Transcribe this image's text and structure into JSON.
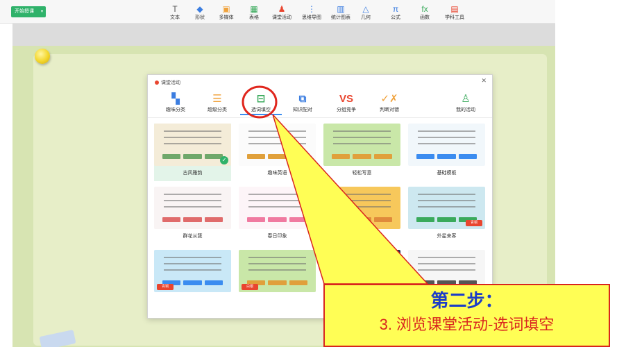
{
  "toolbar": {
    "start_label": "开始授课",
    "tools": [
      {
        "label": "文本",
        "icon": "T",
        "color": "#555555"
      },
      {
        "label": "形状",
        "icon": "◆",
        "color": "#3b7de0"
      },
      {
        "label": "多媒体",
        "icon": "▣",
        "color": "#f0a23b"
      },
      {
        "label": "表格",
        "icon": "▦",
        "color": "#3aaa5c"
      },
      {
        "label": "课堂活动",
        "icon": "♟",
        "color": "#e9452f"
      },
      {
        "label": "思维导图",
        "icon": "⋮",
        "color": "#3b7de0"
      },
      {
        "label": "统计图表",
        "icon": "▥",
        "color": "#3b7de0"
      },
      {
        "label": "几何",
        "icon": "△",
        "color": "#3b7de0"
      },
      {
        "label": "公式",
        "icon": "π",
        "color": "#3b7de0"
      },
      {
        "label": "函数",
        "icon": "fx",
        "color": "#3aaa5c"
      },
      {
        "label": "学科工具",
        "icon": "▤",
        "color": "#e9452f"
      }
    ]
  },
  "dialog": {
    "title": "课堂活动",
    "categories": [
      {
        "label": "趣味分类",
        "icon": "▚",
        "color": "#3b7de0"
      },
      {
        "label": "超级分类",
        "icon": "☰",
        "color": "#f0a23b"
      },
      {
        "label": "选词填空",
        "icon": "⊟",
        "color": "#3aaa5c"
      },
      {
        "label": "知识配对",
        "icon": "⧉",
        "color": "#3b7de0"
      },
      {
        "label": "分组竞争",
        "icon": "VS",
        "color": "#e9452f"
      },
      {
        "label": "判断对错",
        "icon": "✓✗",
        "color": "#f0a23b"
      },
      {
        "label": "我的活动",
        "icon": "♙",
        "color": "#3aaa5c"
      }
    ],
    "templates": [
      {
        "name": "古风雅韵",
        "bg": "#f4ecd8",
        "pill": "#6fa86a"
      },
      {
        "name": "趣味英语",
        "bg": "#fbfbfb",
        "pill": "#e0a03b"
      },
      {
        "name": "轻松写意",
        "bg": "#c9e7a8",
        "pill": "#e0a03b"
      },
      {
        "name": "基础模板",
        "bg": "#f1f7fb",
        "pill": "#3b8cf0"
      },
      {
        "name": "群花从簇",
        "bg": "#f9f4f4",
        "pill": "#e06b6b"
      },
      {
        "name": "春日印象",
        "bg": "#fdf5f8",
        "pill": "#f07aa0"
      },
      {
        "name": "",
        "bg": "#f7c85b",
        "pill": "#e08a3b"
      },
      {
        "name": "外星来客",
        "bg": "#cde8f0",
        "pill": "#3aaa5c"
      },
      {
        "name": "",
        "bg": "#c9e8f7",
        "pill": "#3b8cf0",
        "badge": "青铜"
      },
      {
        "name": "",
        "bg": "#c9e7a8",
        "pill": "#e0a03b",
        "badge": "白银"
      },
      {
        "name": "",
        "bg": "#24324d",
        "pill": "#3b8cf0"
      },
      {
        "name": "",
        "bg": "#f6f6f6",
        "pill": "#555555"
      }
    ],
    "badges": {
      "alien": "青铜"
    }
  },
  "callout": {
    "step": "第二步：",
    "desc": "3. 浏览课堂活动-选词填空"
  }
}
